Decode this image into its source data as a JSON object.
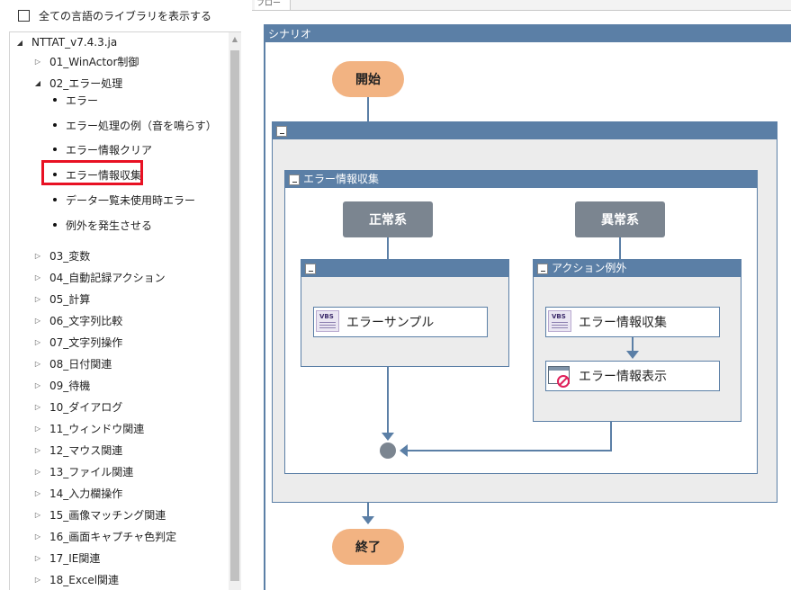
{
  "left_panel": {
    "show_all_label": "全ての言語のライブラリを表示する",
    "tree": {
      "root": "NTTAT_v7.4.3.ja",
      "items": [
        {
          "label": "01_WinActor制御",
          "level": 1,
          "expanded": false
        },
        {
          "label": "02_エラー処理",
          "level": 1,
          "expanded": true
        },
        {
          "label": "エラー",
          "level": 2
        },
        {
          "label": "エラー処理の例（音を鳴らす）",
          "level": 2
        },
        {
          "label": "エラー情報クリア",
          "level": 2
        },
        {
          "label": "エラー情報収集",
          "level": 2,
          "highlighted": true
        },
        {
          "label": "データ一覧未使用時エラー",
          "level": 2
        },
        {
          "label": "例外を発生させる",
          "level": 2
        },
        {
          "label": "03_変数",
          "level": 1,
          "expanded": false
        },
        {
          "label": "04_自動記録アクション",
          "level": 1,
          "expanded": false
        },
        {
          "label": "05_計算",
          "level": 1,
          "expanded": false
        },
        {
          "label": "06_文字列比較",
          "level": 1,
          "expanded": false
        },
        {
          "label": "07_文字列操作",
          "level": 1,
          "expanded": false
        },
        {
          "label": "08_日付関連",
          "level": 1,
          "expanded": false
        },
        {
          "label": "09_待機",
          "level": 1,
          "expanded": false
        },
        {
          "label": "10_ダイアログ",
          "level": 1,
          "expanded": false
        },
        {
          "label": "11_ウィンドウ関連",
          "level": 1,
          "expanded": false
        },
        {
          "label": "12_マウス関連",
          "level": 1,
          "expanded": false
        },
        {
          "label": "13_ファイル関連",
          "level": 1,
          "expanded": false
        },
        {
          "label": "14_入力欄操作",
          "level": 1,
          "expanded": false
        },
        {
          "label": "15_画像マッチング関連",
          "level": 1,
          "expanded": false
        },
        {
          "label": "16_画面キャプチャ色判定",
          "level": 1,
          "expanded": false
        },
        {
          "label": "17_IE関連",
          "level": 1,
          "expanded": false
        },
        {
          "label": "18_Excel関連",
          "level": 1,
          "expanded": false
        }
      ]
    }
  },
  "canvas": {
    "tab_label": "フロー",
    "scenario_title": "シナリオ",
    "start_label": "開始",
    "end_label": "終了",
    "outer_group_title": "",
    "error_group_title": "エラー情報収集",
    "normal_branch_label": "正常系",
    "error_branch_label": "異常系",
    "normal_group_title": "",
    "exception_group_title": "アクション例外",
    "action_sample": "エラーサンプル",
    "action_collect": "エラー情報収集",
    "action_show": "エラー情報表示",
    "vbs_tag": "VBS"
  },
  "colors": {
    "accent_blue": "#5b7fa6",
    "oval_orange": "#f2b382",
    "branch_gray": "#7b8590",
    "highlight_red": "#e81123"
  }
}
